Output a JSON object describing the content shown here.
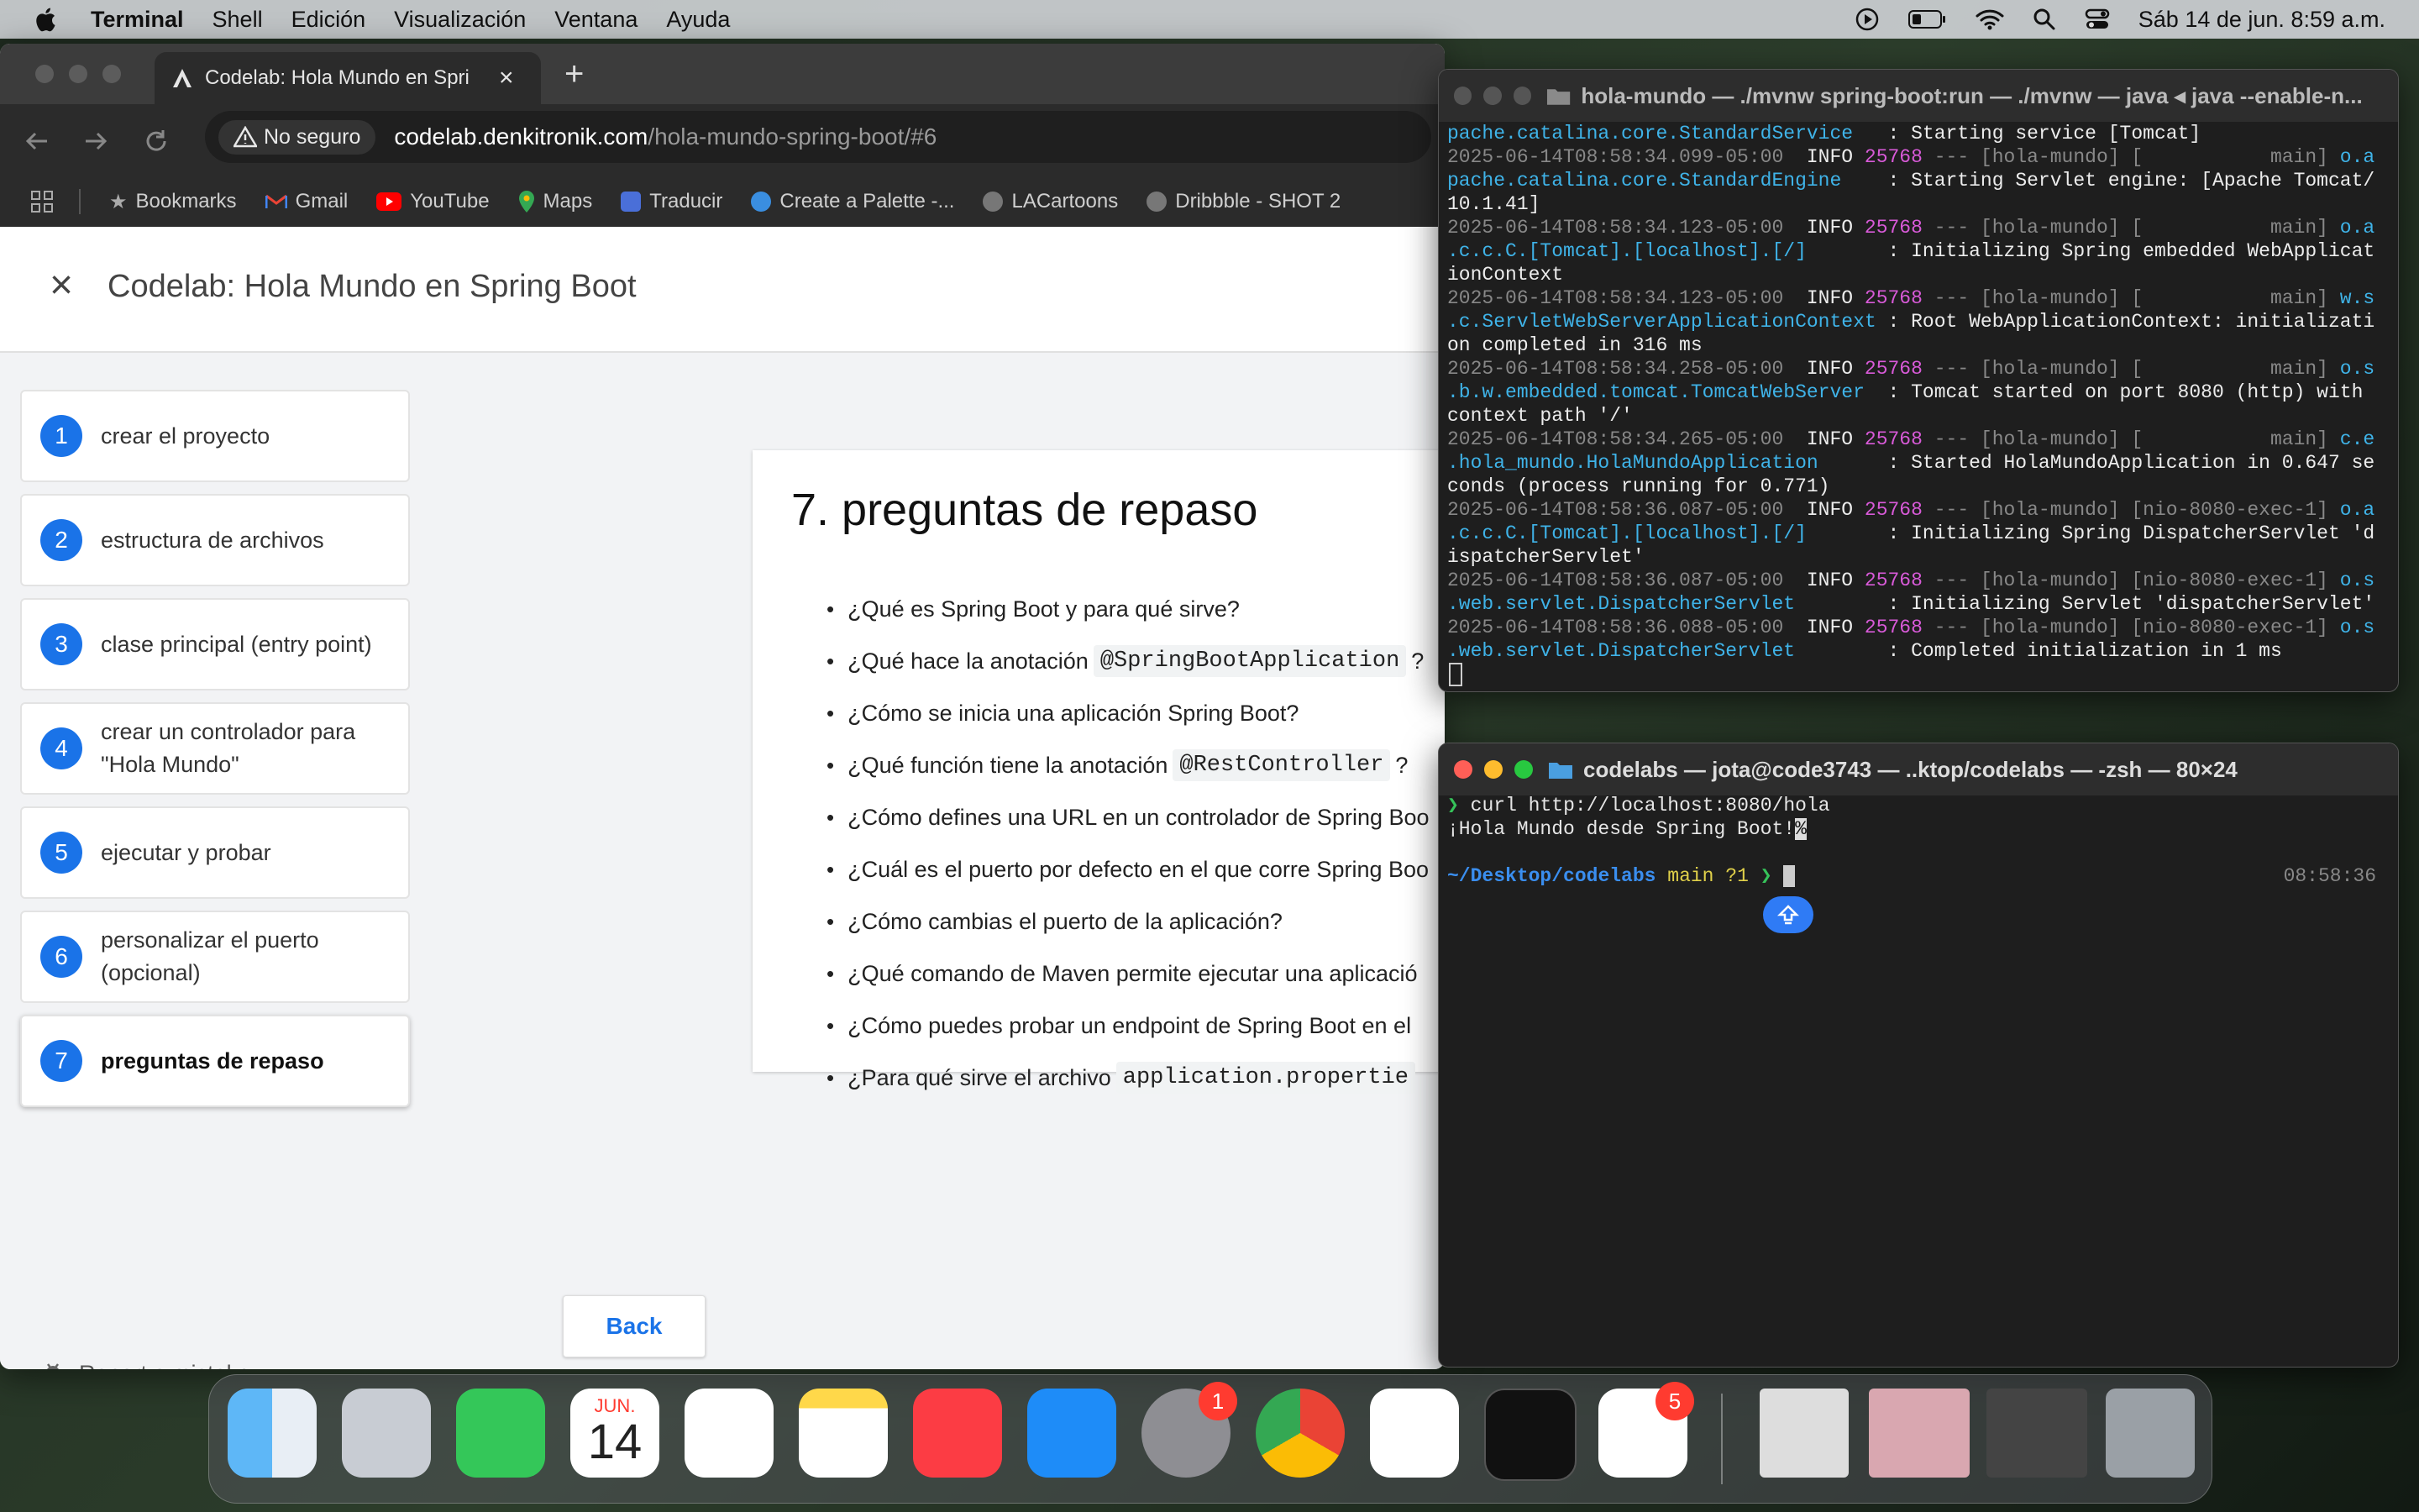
{
  "menubar": {
    "app": "Terminal",
    "items": [
      "Shell",
      "Edición",
      "Visualización",
      "Ventana",
      "Ayuda"
    ],
    "datetime": "Sáb 14 de jun. 8:59 a.m."
  },
  "browser": {
    "tab_title": "Codelab: Hola Mundo en Spri",
    "security_label": "No seguro",
    "url_domain": "codelab.denkitronik.com",
    "url_path": "/hola-mundo-spring-boot/#6",
    "bookmarks": [
      "Bookmarks",
      "Gmail",
      "YouTube",
      "Maps",
      "Traducir",
      "Create a Palette -...",
      "LACartoons",
      "Dribbble - SHOT 2"
    ]
  },
  "codelab": {
    "title": "Codelab: Hola Mundo en Spring Boot",
    "steps": [
      {
        "num": "1",
        "label": "crear el proyecto"
      },
      {
        "num": "2",
        "label": "estructura de archivos"
      },
      {
        "num": "3",
        "label": "clase principal (entry point)"
      },
      {
        "num": "4",
        "label": "crear un controlador para \"Hola Mundo\""
      },
      {
        "num": "5",
        "label": "ejecutar y probar"
      },
      {
        "num": "6",
        "label": "personalizar el puerto (opcional)"
      },
      {
        "num": "7",
        "label": "preguntas de repaso"
      }
    ],
    "section_title": "7. preguntas de repaso",
    "questions": [
      {
        "pre": "¿Qué es Spring Boot y para qué sirve?",
        "code": "",
        "post": ""
      },
      {
        "pre": "¿Qué hace la anotación",
        "code": "@SpringBootApplication",
        "post": "?"
      },
      {
        "pre": "¿Cómo se inicia una aplicación Spring Boot?",
        "code": "",
        "post": ""
      },
      {
        "pre": "¿Qué función tiene la anotación",
        "code": "@RestController",
        "post": "?"
      },
      {
        "pre": "¿Cómo defines una URL en un controlador de Spring Boo",
        "code": "",
        "post": ""
      },
      {
        "pre": "¿Cuál es el puerto por defecto en el que corre Spring Boo",
        "code": "",
        "post": ""
      },
      {
        "pre": "¿Cómo cambias el puerto de la aplicación?",
        "code": "",
        "post": ""
      },
      {
        "pre": "¿Qué comando de Maven permite ejecutar una aplicació",
        "code": "",
        "post": ""
      },
      {
        "pre": "¿Cómo puedes probar un endpoint de Spring Boot en el",
        "code": "",
        "post": ""
      },
      {
        "pre": "¿Para qué sirve el archivo",
        "code": "application.propertie",
        "post": ""
      }
    ],
    "back_label": "Back",
    "report_label": "Report a mistake"
  },
  "terminal_server": {
    "title": "hola-mundo — ./mvnw spring-boot:run — ./mvnw — java ◂ java --enable-n...",
    "lines": [
      [
        {
          "t": "pache.catalina.core.StandardService",
          "c": "cyan"
        },
        {
          "t": "   : Starting service [Tomcat]",
          "c": "white"
        }
      ],
      [
        {
          "t": "2025-06-14T08:58:34.099-05:00  ",
          "c": "grey"
        },
        {
          "t": "INFO ",
          "c": "white"
        },
        {
          "t": "25768",
          "c": "mag"
        },
        {
          "t": " --- [hola-mundo] [           main] ",
          "c": "grey"
        },
        {
          "t": "o.a",
          "c": "cyan"
        }
      ],
      [
        {
          "t": "pache.catalina.core.StandardEngine",
          "c": "cyan"
        },
        {
          "t": "    : Starting Servlet engine: [Apache Tomcat/",
          "c": "white"
        }
      ],
      [
        {
          "t": "10.1.41]",
          "c": "white"
        }
      ],
      [
        {
          "t": "2025-06-14T08:58:34.123-05:00  ",
          "c": "grey"
        },
        {
          "t": "INFO ",
          "c": "white"
        },
        {
          "t": "25768",
          "c": "mag"
        },
        {
          "t": " --- [hola-mundo] [           main] ",
          "c": "grey"
        },
        {
          "t": "o.a",
          "c": "cyan"
        }
      ],
      [
        {
          "t": ".c.c.C.[Tomcat].[localhost].[/]",
          "c": "cyan"
        },
        {
          "t": "       : Initializing Spring embedded WebApplicat",
          "c": "white"
        }
      ],
      [
        {
          "t": "ionContext",
          "c": "white"
        }
      ],
      [
        {
          "t": "2025-06-14T08:58:34.123-05:00  ",
          "c": "grey"
        },
        {
          "t": "INFO ",
          "c": "white"
        },
        {
          "t": "25768",
          "c": "mag"
        },
        {
          "t": " --- [hola-mundo] [           main] ",
          "c": "grey"
        },
        {
          "t": "w.s",
          "c": "cyan"
        }
      ],
      [
        {
          "t": ".c.ServletWebServerApplicationContext",
          "c": "cyan"
        },
        {
          "t": " : Root WebApplicationContext: initializati",
          "c": "white"
        }
      ],
      [
        {
          "t": "on completed in 316 ms",
          "c": "white"
        }
      ],
      [
        {
          "t": "2025-06-14T08:58:34.258-05:00  ",
          "c": "grey"
        },
        {
          "t": "INFO ",
          "c": "white"
        },
        {
          "t": "25768",
          "c": "mag"
        },
        {
          "t": " --- [hola-mundo] [           main] ",
          "c": "grey"
        },
        {
          "t": "o.s",
          "c": "cyan"
        }
      ],
      [
        {
          "t": ".b.w.embedded.tomcat.TomcatWebServer",
          "c": "cyan"
        },
        {
          "t": "  : Tomcat started on port 8080 (http) with",
          "c": "white"
        }
      ],
      [
        {
          "t": "context path '/'",
          "c": "white"
        }
      ],
      [
        {
          "t": "2025-06-14T08:58:34.265-05:00  ",
          "c": "grey"
        },
        {
          "t": "INFO ",
          "c": "white"
        },
        {
          "t": "25768",
          "c": "mag"
        },
        {
          "t": " --- [hola-mundo] [           main] ",
          "c": "grey"
        },
        {
          "t": "c.e",
          "c": "cyan"
        }
      ],
      [
        {
          "t": ".hola_mundo.HolaMundoApplication",
          "c": "cyan"
        },
        {
          "t": "      : Started HolaMundoApplication in 0.647 se",
          "c": "white"
        }
      ],
      [
        {
          "t": "conds (process running for 0.771)",
          "c": "white"
        }
      ],
      [
        {
          "t": "2025-06-14T08:58:36.087-05:00  ",
          "c": "grey"
        },
        {
          "t": "INFO ",
          "c": "white"
        },
        {
          "t": "25768",
          "c": "mag"
        },
        {
          "t": " --- [hola-mundo] [nio-8080-exec-1] ",
          "c": "grey"
        },
        {
          "t": "o.a",
          "c": "cyan"
        }
      ],
      [
        {
          "t": ".c.c.C.[Tomcat].[localhost].[/]",
          "c": "cyan"
        },
        {
          "t": "       : Initializing Spring DispatcherServlet 'd",
          "c": "white"
        }
      ],
      [
        {
          "t": "ispatcherServlet'",
          "c": "white"
        }
      ],
      [
        {
          "t": "2025-06-14T08:58:36.087-05:00  ",
          "c": "grey"
        },
        {
          "t": "INFO ",
          "c": "white"
        },
        {
          "t": "25768",
          "c": "mag"
        },
        {
          "t": " --- [hola-mundo] [nio-8080-exec-1] ",
          "c": "grey"
        },
        {
          "t": "o.s",
          "c": "cyan"
        }
      ],
      [
        {
          "t": ".web.servlet.DispatcherServlet",
          "c": "cyan"
        },
        {
          "t": "        : Initializing Servlet 'dispatcherServlet'",
          "c": "white"
        }
      ],
      [
        {
          "t": "2025-06-14T08:58:36.088-05:00  ",
          "c": "grey"
        },
        {
          "t": "INFO ",
          "c": "white"
        },
        {
          "t": "25768",
          "c": "mag"
        },
        {
          "t": " --- [hola-mundo] [nio-8080-exec-1] ",
          "c": "grey"
        },
        {
          "t": "o.s",
          "c": "cyan"
        }
      ],
      [
        {
          "t": ".web.servlet.DispatcherServlet",
          "c": "cyan"
        },
        {
          "t": "        : Completed initialization in 1 ms",
          "c": "white"
        }
      ]
    ]
  },
  "terminal_client": {
    "title": "codelabs — jota@code3743 — ..ktop/codelabs — -zsh — 80×24",
    "command": "curl http://localhost:8080/hola",
    "output": "¡Hola Mundo desde Spring Boot!",
    "prompt_dir_prefix": "~/Desktop/",
    "prompt_dir": "codelabs",
    "prompt_branch": "main ?1",
    "prompt_time": "08:58:36"
  },
  "dock": {
    "calendar_month": "JUN.",
    "calendar_day": "14",
    "settings_badge": "1",
    "office_badge": "5"
  },
  "colors": {
    "accent": "#1a73e8",
    "term_bg": "#1e1e1e"
  }
}
